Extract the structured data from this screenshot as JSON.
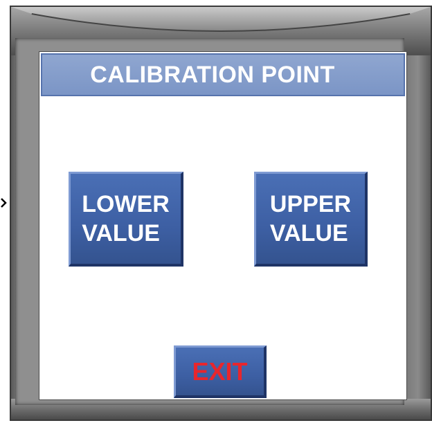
{
  "panel": {
    "title": "CALIBRATION POINT"
  },
  "buttons": {
    "lower_value": "LOWER\nVALUE",
    "upper_value": "UPPER\nVALUE",
    "exit": "EXIT"
  },
  "colors": {
    "title_bar": "#7b95c6",
    "button_face": "#3d5fa3",
    "button_text": "#ffffff",
    "exit_text": "#e8262d",
    "bezel": "#6d6d6d",
    "screen_bg": "#ffffff"
  }
}
